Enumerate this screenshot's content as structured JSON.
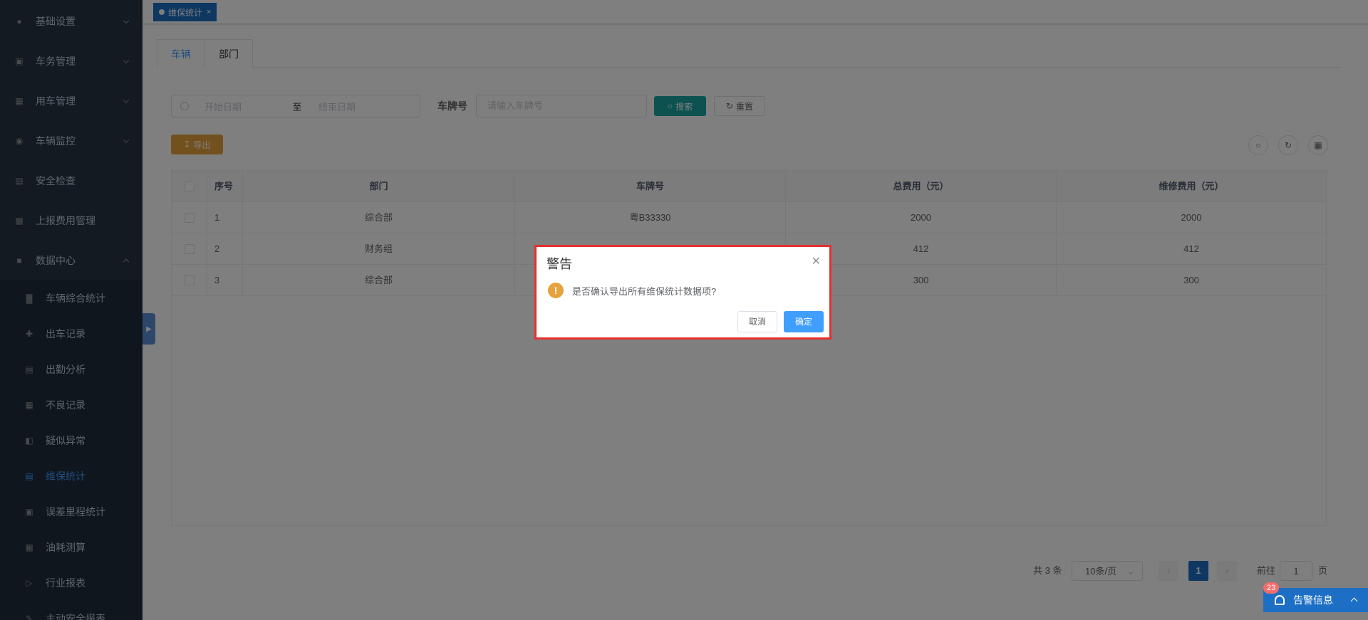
{
  "sidebar": {
    "items": [
      {
        "label": "基础设置",
        "icon": "user-settings-icon"
      },
      {
        "label": "车务管理",
        "icon": "monitor-icon"
      },
      {
        "label": "用车管理",
        "icon": "car-use-icon"
      },
      {
        "label": "车辆监控",
        "icon": "globe-icon"
      },
      {
        "label": "安全检查",
        "icon": "checklist-icon"
      },
      {
        "label": "上报费用管理",
        "icon": "grid-icon"
      },
      {
        "label": "数据中心",
        "icon": "lock-icon"
      }
    ],
    "subitems": [
      {
        "label": "车辆综合统计",
        "icon": "bar-chart-icon"
      },
      {
        "label": "出车记录",
        "icon": "move-icon"
      },
      {
        "label": "出勤分析",
        "icon": "attendance-icon"
      },
      {
        "label": "不良记录",
        "icon": "table-icon"
      },
      {
        "label": "疑似异常",
        "icon": "alert-doc-icon"
      },
      {
        "label": "维保统计",
        "icon": "doc-icon"
      },
      {
        "label": "误差里程统计",
        "icon": "mileage-icon"
      },
      {
        "label": "油耗测算",
        "icon": "fuel-icon"
      },
      {
        "label": "行业报表",
        "icon": "report-icon"
      },
      {
        "label": "主动安全报表",
        "icon": "edit-icon"
      }
    ]
  },
  "tags": {
    "active_tag": "维保统计",
    "close": "×"
  },
  "tabs": [
    "车辆",
    "部门"
  ],
  "filters": {
    "date_start_placeholder": "开始日期",
    "date_separator": "至",
    "date_end_placeholder": "结束日期",
    "plate_label": "车牌号",
    "plate_placeholder": "请输入车牌号",
    "search_label": "搜索",
    "reset_label": "重置"
  },
  "toolbar": {
    "export_label": "导出"
  },
  "table": {
    "columns": [
      "序号",
      "部门",
      "车牌号",
      "总费用（元）",
      "维修费用（元）"
    ],
    "rows": [
      {
        "index": "1",
        "dept": "综合部",
        "plate": "粤B33330",
        "total": "2000",
        "repair": "2000"
      },
      {
        "index": "2",
        "dept": "财务组",
        "plate": "",
        "total": "412",
        "repair": "412"
      },
      {
        "index": "3",
        "dept": "综合部",
        "plate": "",
        "total": "300",
        "repair": "300"
      }
    ]
  },
  "pagination": {
    "total_text": "共 3 条",
    "page_size": "10条/页",
    "current_page": "1",
    "goto_label": "前往",
    "goto_value": "1",
    "page_suffix": "页"
  },
  "dialog": {
    "title": "警告",
    "message": "是否确认导出所有维保统计数据项?",
    "cancel_label": "取消",
    "ok_label": "确定"
  },
  "alarm": {
    "label": "告警信息",
    "count": "23"
  },
  "colors": {
    "sidebar": "#263445",
    "active_blue": "#409eff",
    "tag_blue": "#1d6fc5",
    "search_teal": "#1aa3a1",
    "export_orange": "#e6a23c",
    "highlight_red": "#e53030"
  }
}
